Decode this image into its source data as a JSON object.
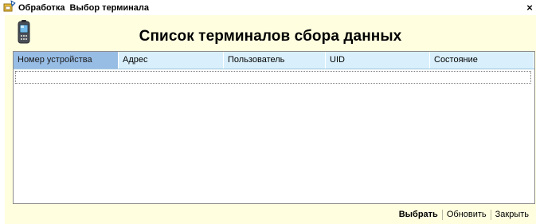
{
  "window": {
    "title": "Обработка  Выбор терминала",
    "close_glyph": "×",
    "icons": {
      "title": "processing-icon",
      "header": "pda-terminal-icon"
    }
  },
  "heading": "Список терминалов сбора данных",
  "table": {
    "columns": [
      "Номер устройства",
      "Адрес",
      "Пользователь",
      "UID",
      "Состояние"
    ],
    "active_column": "Номер устройства",
    "rows": []
  },
  "actions": {
    "select_label": "Выбрать",
    "refresh_label": "Обновить",
    "close_label": "Закрыть"
  },
  "colors": {
    "form_background": "#ffffe0",
    "header_background": "#d9f0fc",
    "active_header": "#98bde5"
  }
}
